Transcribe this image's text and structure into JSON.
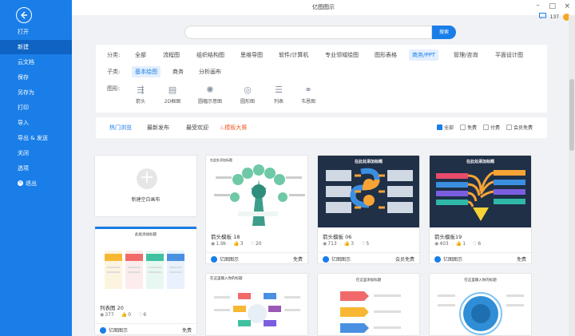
{
  "window": {
    "title": "亿图图示"
  },
  "toolbar": {
    "count": "137"
  },
  "sidebar": {
    "items": [
      {
        "label": "打开"
      },
      {
        "label": "新建"
      },
      {
        "label": "云文档"
      },
      {
        "label": "保存"
      },
      {
        "label": "另存为"
      },
      {
        "label": "打印"
      },
      {
        "label": "导入"
      },
      {
        "label": "导出 & 发送"
      },
      {
        "label": "关闭"
      },
      {
        "label": "选项"
      },
      {
        "label": "退出"
      }
    ]
  },
  "search": {
    "placeholder": "",
    "button": "搜索"
  },
  "filter": {
    "category_label": "分类:",
    "categories": [
      "全部",
      "流程图",
      "组织结构图",
      "思维导图",
      "软件/计算机",
      "专业领域绘图",
      "图形表格",
      "商务/PPT",
      "管理/咨询",
      "平面设计图"
    ],
    "sub_label": "子类:",
    "subs": [
      "基本绘图",
      "商务",
      "分析画布"
    ],
    "shape_label": "图形:",
    "shapes": [
      "箭头",
      "2D框图",
      "圆幅示意图",
      "圆形图",
      "列表",
      "韦恩图"
    ]
  },
  "tabs": [
    "热门浏览",
    "最新发布",
    "最受欢迎",
    "模板大赛"
  ],
  "checks": [
    "全部",
    "免费",
    "付费",
    "会员免费"
  ],
  "cards": {
    "new_label": "新建空白画布",
    "items": [
      {
        "name": "箭头模板 18",
        "views": "1.9k",
        "likes": "3",
        "favs": "20",
        "brand": "亿图图示",
        "price": "免费",
        "thumb_title": "在此处添加标题"
      },
      {
        "name": "箭头模板 06",
        "views": "713",
        "likes": "3",
        "favs": "5",
        "brand": "亿图图示",
        "price": "会员免费",
        "thumb_title": "在此处添加标题"
      },
      {
        "name": "箭头模板19",
        "views": "403",
        "likes": "1",
        "favs": "6",
        "brand": "亿图图示",
        "price": "免费",
        "thumb_title": "在此处添加标题"
      },
      {
        "name": "列表图 20",
        "views": "377",
        "likes": "0",
        "favs": "6",
        "brand": "亿图图示",
        "price": "免费",
        "thumb_title": "此处添加标题"
      },
      {
        "thumb_title": "在这里输入你的标题"
      },
      {
        "thumb_title": "在这里添加标题"
      },
      {
        "thumb_title": "在这里输入你的标题"
      }
    ]
  },
  "colors": {
    "accent": "#1a7ee8",
    "sidebar": "#1a7ee8",
    "sidebar_active": "#0f63c2",
    "hot": "#f05a28",
    "dark_thumb": "#1f3047"
  }
}
